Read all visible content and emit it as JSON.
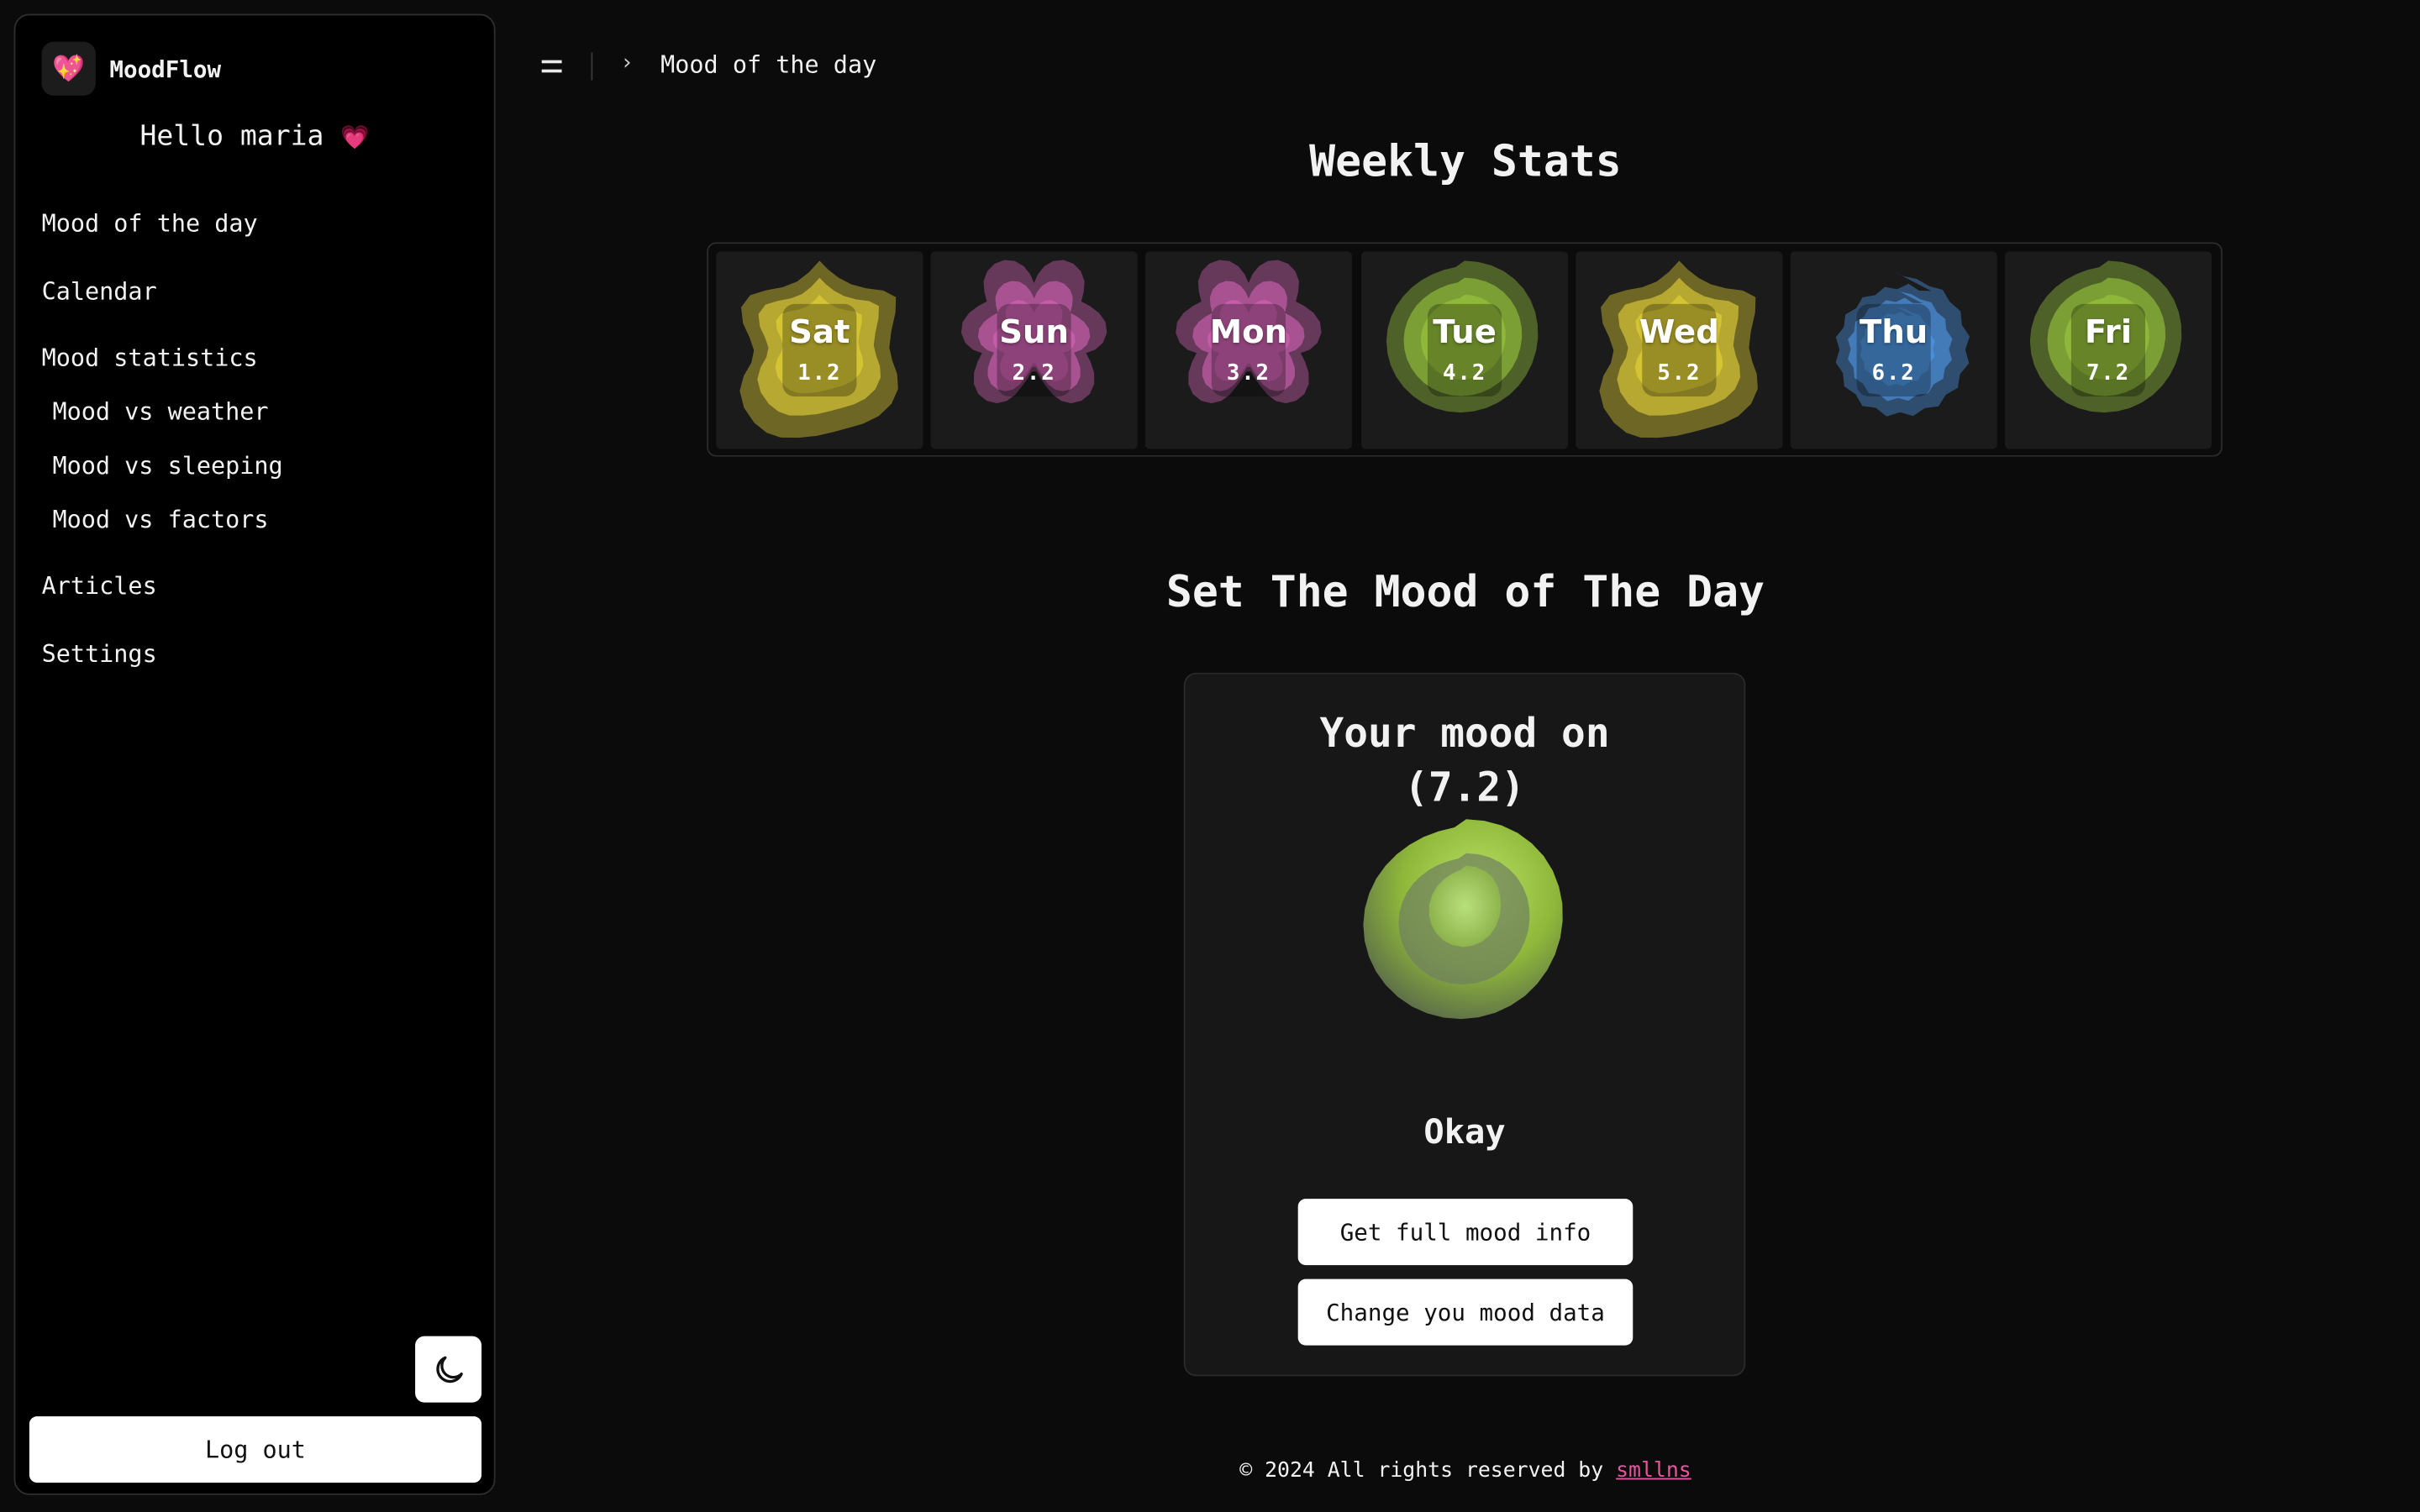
{
  "app": {
    "name": "MoodFlow",
    "logo_icon": "sparkling-heart-icon"
  },
  "sidebar": {
    "greeting": "Hello maria",
    "greeting_emoji": "💗",
    "nav": [
      {
        "label": "Mood of the day"
      },
      {
        "label": "Calendar"
      },
      {
        "label": "Mood statistics"
      },
      {
        "label": "Mood vs weather"
      },
      {
        "label": "Mood vs sleeping"
      },
      {
        "label": "Mood vs factors"
      },
      {
        "label": "Articles"
      },
      {
        "label": "Settings"
      }
    ],
    "theme_toggle_icon": "moon-icon",
    "logout_label": "Log out"
  },
  "header": {
    "breadcrumb": "Mood of the day"
  },
  "weekly": {
    "title": "Weekly Stats",
    "days": [
      {
        "day": "Sat",
        "score": "1.2",
        "color": "#d4c434"
      },
      {
        "day": "Sun",
        "score": "2.2",
        "color": "#c45ea8"
      },
      {
        "day": "Mon",
        "score": "3.2",
        "color": "#c45ea8"
      },
      {
        "day": "Tue",
        "score": "4.2",
        "color": "#8fb83a"
      },
      {
        "day": "Wed",
        "score": "5.2",
        "color": "#d4c434"
      },
      {
        "day": "Thu",
        "score": "6.2",
        "color": "#4a8fd6"
      },
      {
        "day": "Fri",
        "score": "7.2",
        "color": "#8fb83a"
      }
    ]
  },
  "set_mood": {
    "title": "Set The Mood of The Day",
    "card_title_line1": "Your mood on",
    "card_title_line2": "(7.2)",
    "status": "Okay",
    "color": "#9bc94a",
    "full_info_label": "Get full mood info",
    "change_label": "Change you mood data"
  },
  "footer": {
    "text": "© 2024 All rights reserved by",
    "link": "smllns"
  }
}
